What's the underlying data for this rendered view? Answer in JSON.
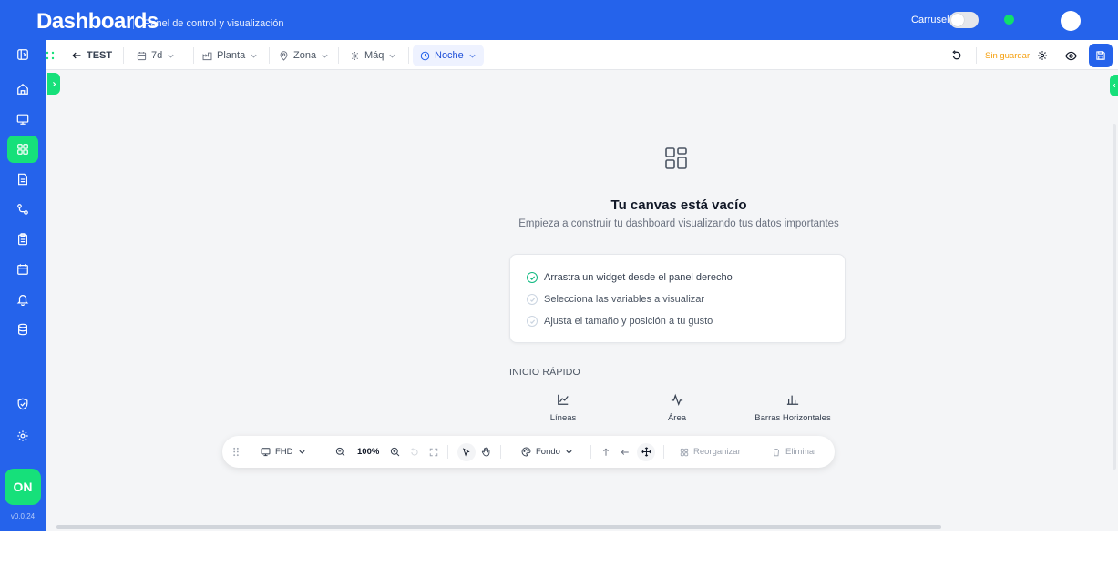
{
  "topbar": {
    "title": "Dashboards",
    "subtitle": "Panel de control y visualización",
    "carousel_label": "Carrusel"
  },
  "sidebar": {
    "items": [
      {
        "icon": "sidebar-collapse-icon"
      },
      {
        "icon": "home-icon"
      },
      {
        "icon": "monitor-icon"
      },
      {
        "icon": "dashboard-grid-icon",
        "active": true
      },
      {
        "icon": "document-icon"
      },
      {
        "icon": "workflow-icon"
      },
      {
        "icon": "clipboard-icon"
      },
      {
        "icon": "calendar-icon"
      },
      {
        "icon": "bell-icon"
      },
      {
        "icon": "database-icon"
      },
      {
        "icon": "shield-icon"
      },
      {
        "icon": "gear-icon"
      }
    ],
    "logo_text": "ON",
    "version": "v0.0.24"
  },
  "toolbar": {
    "back_label": "TEST",
    "period": "7d",
    "plant": "Planta",
    "zone": "Zona",
    "machine": "Máq",
    "shift": "Noche",
    "unsaved_text": "Sin guardar"
  },
  "canvas": {
    "empty_title": "Tu canvas está vacío",
    "empty_subtitle": "Empieza a construir tu dashboard visualizando tus datos importantes",
    "steps": [
      {
        "text": "Arrastra un widget desde el panel derecho",
        "done": true
      },
      {
        "text": "Selecciona las variables a visualizar",
        "done": false
      },
      {
        "text": "Ajusta el tamaño y posición a tu gusto",
        "done": false
      }
    ],
    "quick_start_title": "INICIO RÁPIDO",
    "quick_items": [
      {
        "label": "Líneas",
        "icon": "line-chart-icon"
      },
      {
        "label": "Área",
        "icon": "area-chart-icon"
      },
      {
        "label": "Barras Horizontales",
        "icon": "bar-chart-icon"
      }
    ]
  },
  "bottom_bar": {
    "resolution": "FHD",
    "zoom": "100%",
    "background_label": "Fondo",
    "reorganize_label": "Reorganizar",
    "delete_label": "Eliminar"
  },
  "colors": {
    "primary": "#2563eb",
    "accent": "#16e07a",
    "warning": "#f59e0b",
    "shift_active": "#2563eb"
  }
}
